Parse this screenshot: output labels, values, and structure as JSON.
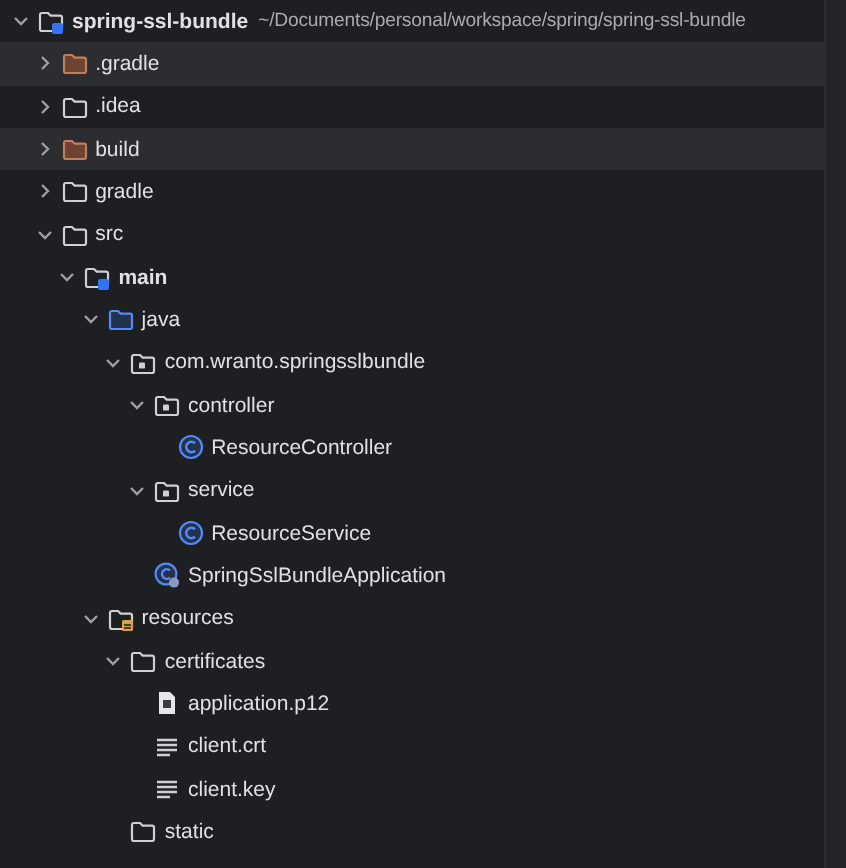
{
  "project_tree": {
    "root": {
      "name": "spring-ssl-bundle",
      "path": "~/Documents/personal/workspace/spring/spring-ssl-bundle",
      "kind": "module",
      "expanded": true,
      "children": [
        {
          "name": ".gradle",
          "kind": "excluded-folder",
          "expanded": false
        },
        {
          "name": ".idea",
          "kind": "folder",
          "expanded": false
        },
        {
          "name": "build",
          "kind": "excluded-folder",
          "expanded": false
        },
        {
          "name": "gradle",
          "kind": "folder",
          "expanded": false
        },
        {
          "name": "src",
          "kind": "folder",
          "expanded": true,
          "children": [
            {
              "name": "main",
              "kind": "module",
              "expanded": true,
              "children": [
                {
                  "name": "java",
                  "kind": "source-folder",
                  "expanded": true,
                  "children": [
                    {
                      "name": "com.wranto.springsslbundle",
                      "kind": "package",
                      "expanded": true,
                      "children": [
                        {
                          "name": "controller",
                          "kind": "package",
                          "expanded": true,
                          "children": [
                            {
                              "name": "ResourceController",
                              "kind": "class"
                            }
                          ]
                        },
                        {
                          "name": "service",
                          "kind": "package",
                          "expanded": true,
                          "children": [
                            {
                              "name": "ResourceService",
                              "kind": "class"
                            }
                          ]
                        },
                        {
                          "name": "SpringSslBundleApplication",
                          "kind": "app-class"
                        }
                      ]
                    }
                  ]
                },
                {
                  "name": "resources",
                  "kind": "resources-folder",
                  "expanded": true,
                  "children": [
                    {
                      "name": "certificates",
                      "kind": "folder",
                      "expanded": true,
                      "children": [
                        {
                          "name": "application.p12",
                          "kind": "binary-file"
                        },
                        {
                          "name": "client.crt",
                          "kind": "text-file"
                        },
                        {
                          "name": "client.key",
                          "kind": "text-file"
                        }
                      ]
                    },
                    {
                      "name": "static",
                      "kind": "folder"
                    }
                  ]
                }
              ]
            }
          ]
        }
      ]
    }
  }
}
